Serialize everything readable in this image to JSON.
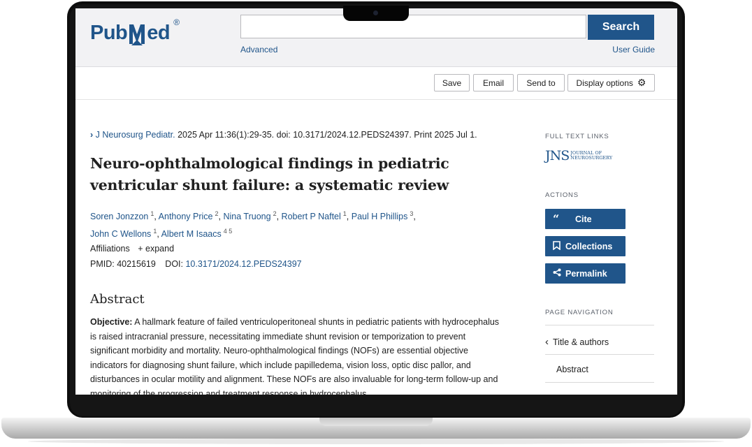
{
  "header": {
    "logo_text_left": "Pub",
    "logo_text_right": "ed",
    "search_button": "Search",
    "advanced_link": "Advanced",
    "user_guide_link": "User Guide"
  },
  "toolbar": {
    "save": "Save",
    "email": "Email",
    "send_to": "Send to",
    "display_options": "Display options"
  },
  "article": {
    "journal_chevron": "›",
    "journal_name": "J Neurosurg Pediatr.",
    "citation": " 2025 Apr 11:36(1):29-35. doi: 10.3171/2024.12.PEDS24397. Print 2025 Jul 1.",
    "title": "Neuro-ophthalmological findings in pediatric ventricular shunt failure: a systematic review",
    "authors": [
      {
        "name": "Soren Jonzzon",
        "aff": "1"
      },
      {
        "name": "Anthony Price",
        "aff": "2"
      },
      {
        "name": "Nina Truong",
        "aff": "2"
      },
      {
        "name": "Robert P Naftel",
        "aff": "1"
      },
      {
        "name": "Paul H Phillips",
        "aff": "3"
      },
      {
        "name": "John C Wellons",
        "aff": "1"
      },
      {
        "name": "Albert M Isaacs",
        "aff": "4 5"
      }
    ],
    "affiliations_label": "Affiliations",
    "expand_label": "+ expand",
    "pmid_label": "PMID: 40215619",
    "doi_label": "DOI:",
    "doi_value": "10.3171/2024.12.PEDS24397",
    "abstract_heading": "Abstract",
    "objective_label": "Objective:",
    "abstract_text": " A hallmark feature of failed ventriculoperitoneal shunts in pediatric patients with hydrocephalus is raised intracranial pressure, necessitating immediate shunt revision or temporization to prevent significant morbidity and mortality. Neuro-ophthalmological findings (NOFs) are essential objective indicators for diagnosing shunt failure, which include papilledema, vision loss, optic disc pallor, and disturbances in ocular motility and alignment. These NOFs are also invaluable for long-term follow-up and monitoring of the progression and treatment response in hydrocephalus."
  },
  "sidebar": {
    "full_text_links_label": "FULL TEXT LINKS",
    "jns_big": "JNS",
    "jns_line1": "JOURNAL OF",
    "jns_line2": "NEUROSURGERY",
    "actions_label": "ACTIONS",
    "cite": "Cite",
    "collections": "Collections",
    "permalink": "Permalink",
    "page_nav_label": "PAGE NAVIGATION",
    "nav_title_authors": "Title & authors",
    "nav_abstract": "Abstract"
  },
  "colors": {
    "brand": "#20558a",
    "text": "#212121"
  }
}
